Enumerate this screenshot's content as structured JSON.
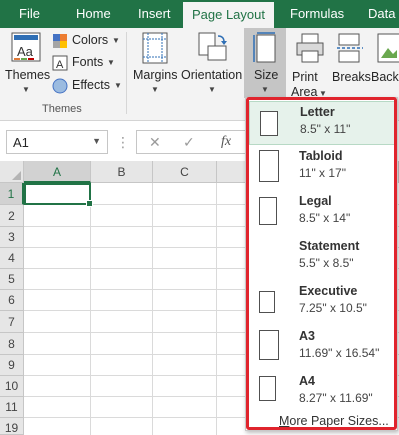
{
  "tabs": [
    {
      "label": "File",
      "active": false
    },
    {
      "label": "Home",
      "active": false
    },
    {
      "label": "Insert",
      "active": false
    },
    {
      "label": "Page Layout",
      "active": true
    },
    {
      "label": "Formulas",
      "active": false
    },
    {
      "label": "Data",
      "active": false
    }
  ],
  "ribbon": {
    "themes_label": "Themes",
    "colors_label": "Colors",
    "fonts_label": "Fonts",
    "effects_label": "Effects",
    "themes_group_label": "Themes",
    "margins_label": "Margins",
    "orientation_label": "Orientation",
    "size_label": "Size",
    "print_area_line1": "Print",
    "print_area_line2": "Area",
    "breaks_label": "Breaks",
    "background_label": "Back-"
  },
  "formula_bar": {
    "name_box": "A1",
    "cancel_glyph": "✕",
    "enter_glyph": "✓",
    "fx_glyph": "fx",
    "formula_value": ""
  },
  "grid": {
    "columns": [
      "A",
      "B",
      "C"
    ],
    "rows": [
      "1",
      "2",
      "3",
      "4",
      "5",
      "6",
      "7",
      "8",
      "9",
      "10",
      "11",
      "19"
    ],
    "selected_cell": "A1"
  },
  "size_menu": {
    "items": [
      {
        "name": "Letter",
        "dims": "8.5\" x 11\"",
        "selected": true
      },
      {
        "name": "Tabloid",
        "dims": "11\" x 17\"",
        "selected": false
      },
      {
        "name": "Legal",
        "dims": "8.5\" x 14\"",
        "selected": false
      },
      {
        "name": "Statement",
        "dims": "5.5\" x 8.5\"",
        "selected": false
      },
      {
        "name": "Executive",
        "dims": "7.25\" x 10.5\"",
        "selected": false
      },
      {
        "name": "A3",
        "dims": "11.69\" x 16.54\"",
        "selected": false
      },
      {
        "name": "A4",
        "dims": "8.27\" x 11.69\"",
        "selected": false
      }
    ],
    "more_underlined": "M",
    "more_rest": "ore Paper Sizes..."
  },
  "colors": {
    "excel_green": "#217346",
    "highlight_red": "#e0242d",
    "selected_item_bg": "#e6f2eb"
  }
}
